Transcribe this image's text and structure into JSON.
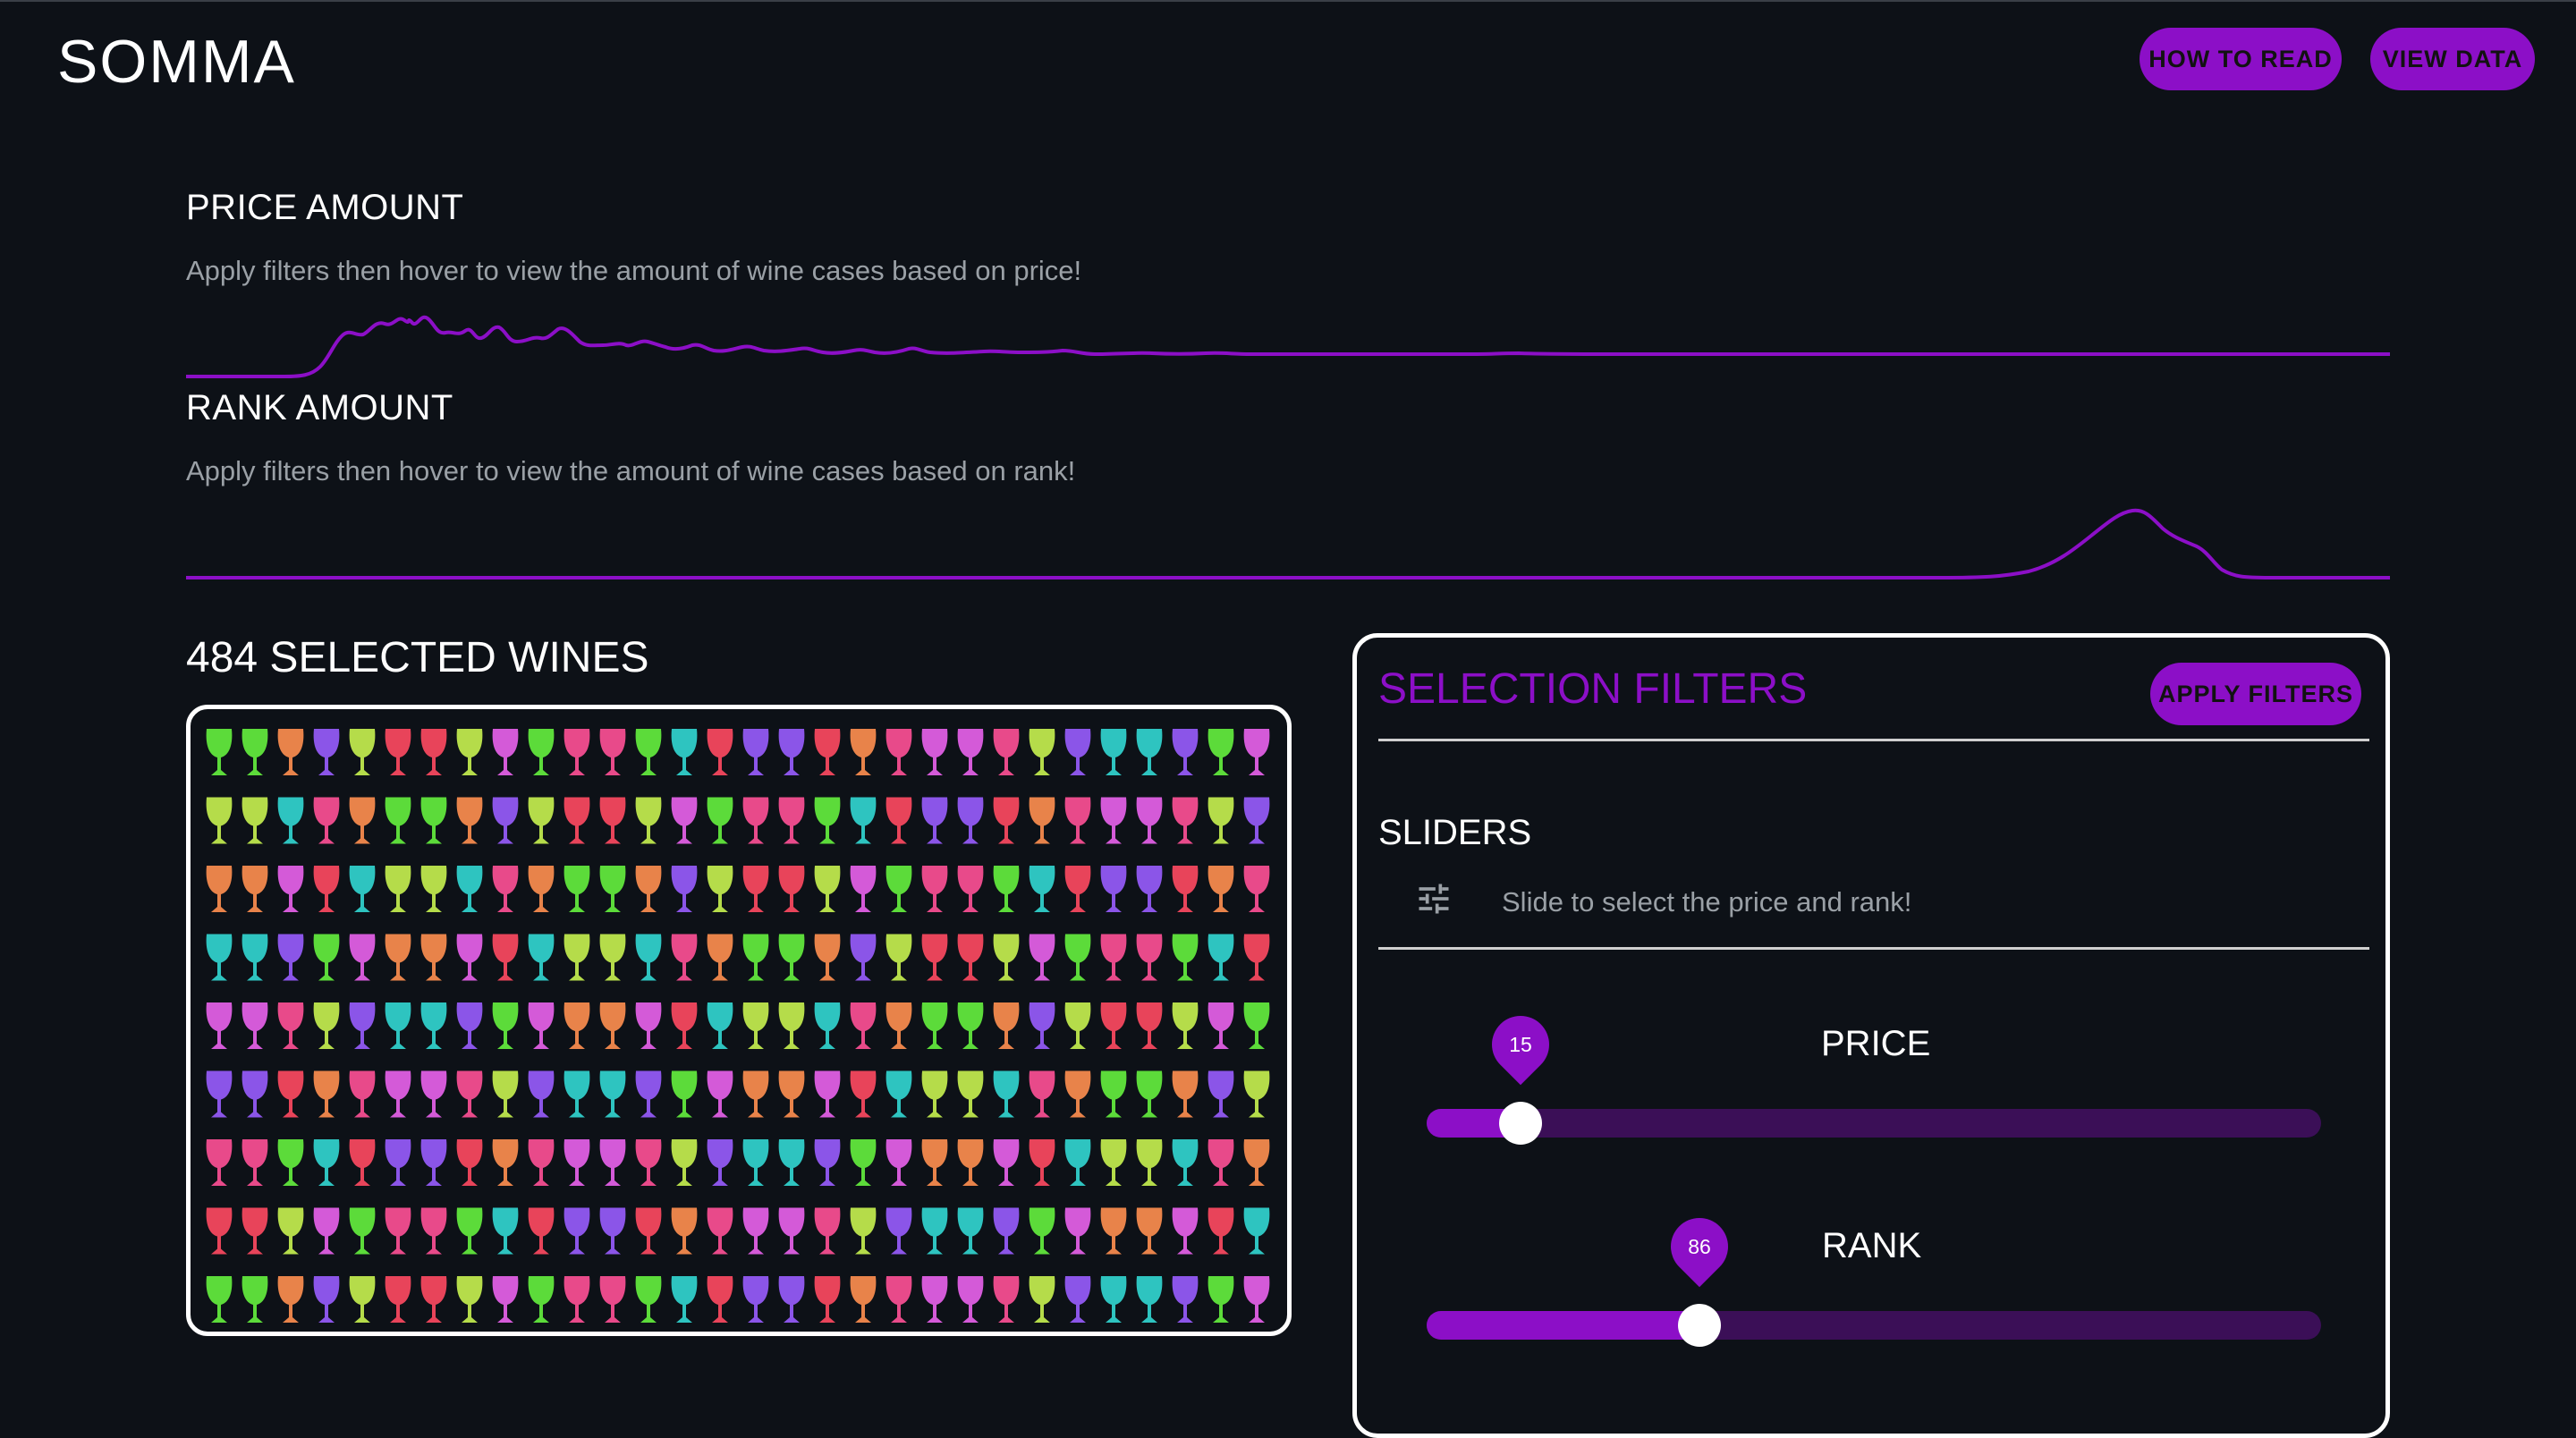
{
  "app": {
    "title": "SOMMA"
  },
  "header": {
    "how_to_read": "HOW TO READ",
    "view_data": "VIEW DATA"
  },
  "accent_color": "#8c0fc7",
  "price_amount": {
    "title": "PRICE AMOUNT",
    "description": "Apply filters then hover to view the amount of wine cases based on price!"
  },
  "rank_amount": {
    "title": "RANK AMOUNT",
    "description": "Apply filters then hover to view the amount of wine cases based on rank!"
  },
  "selected": {
    "title": "484 SELECTED WINES",
    "count": 484
  },
  "wine_colors": [
    "#5cdb3a",
    "#8b55e8",
    "#e8834a",
    "#e8445a",
    "#d45ad8",
    "#b5dc4a",
    "#e84a8a",
    "#2ec4c0"
  ],
  "filters": {
    "title": "SELECTION FILTERS",
    "apply_label": "APPLY FILTERS",
    "sliders_title": "SLIDERS",
    "sliders_icon": "tune-icon",
    "sliders_desc": "Slide to select the price and rank!",
    "price": {
      "label": "PRICE",
      "value": "15",
      "fraction": 0.105
    },
    "rank": {
      "label": "RANK",
      "value": "86",
      "fraction": 0.305
    }
  }
}
